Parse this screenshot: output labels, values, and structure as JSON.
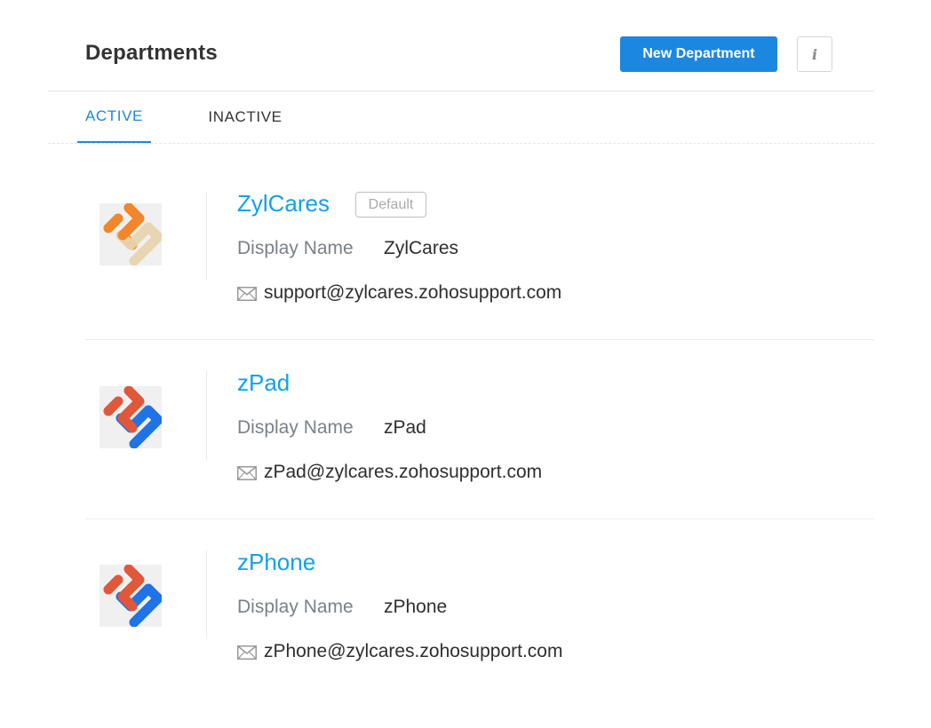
{
  "header": {
    "title": "Departments",
    "new_department_label": "New Department",
    "info_label": "i"
  },
  "tabs": [
    {
      "label": "ACTIVE",
      "active": true
    },
    {
      "label": "INACTIVE",
      "active": false
    }
  ],
  "departments": [
    {
      "name": "ZylCares",
      "badge": "Default",
      "display_name_label": "Display Name",
      "display_name": "ZylCares",
      "email": "support@zylcares.zohosupport.com",
      "logo_colors": [
        "#f1862a",
        "#e6d4ad"
      ]
    },
    {
      "name": "zPad",
      "display_name_label": "Display Name",
      "display_name": "zPad",
      "email": "zPad@zylcares.zohosupport.com",
      "logo_colors": [
        "#e0573a",
        "#1f73e6"
      ]
    },
    {
      "name": "zPhone",
      "display_name_label": "Display Name",
      "display_name": "zPhone",
      "email": "zPhone@zylcares.zohosupport.com",
      "logo_colors": [
        "#e0573a",
        "#1f73e6"
      ]
    }
  ],
  "icons": {
    "email": "envelope-icon",
    "info": "info-icon"
  },
  "colors": {
    "accent": "#1c87e0",
    "link": "#12a0e8"
  }
}
